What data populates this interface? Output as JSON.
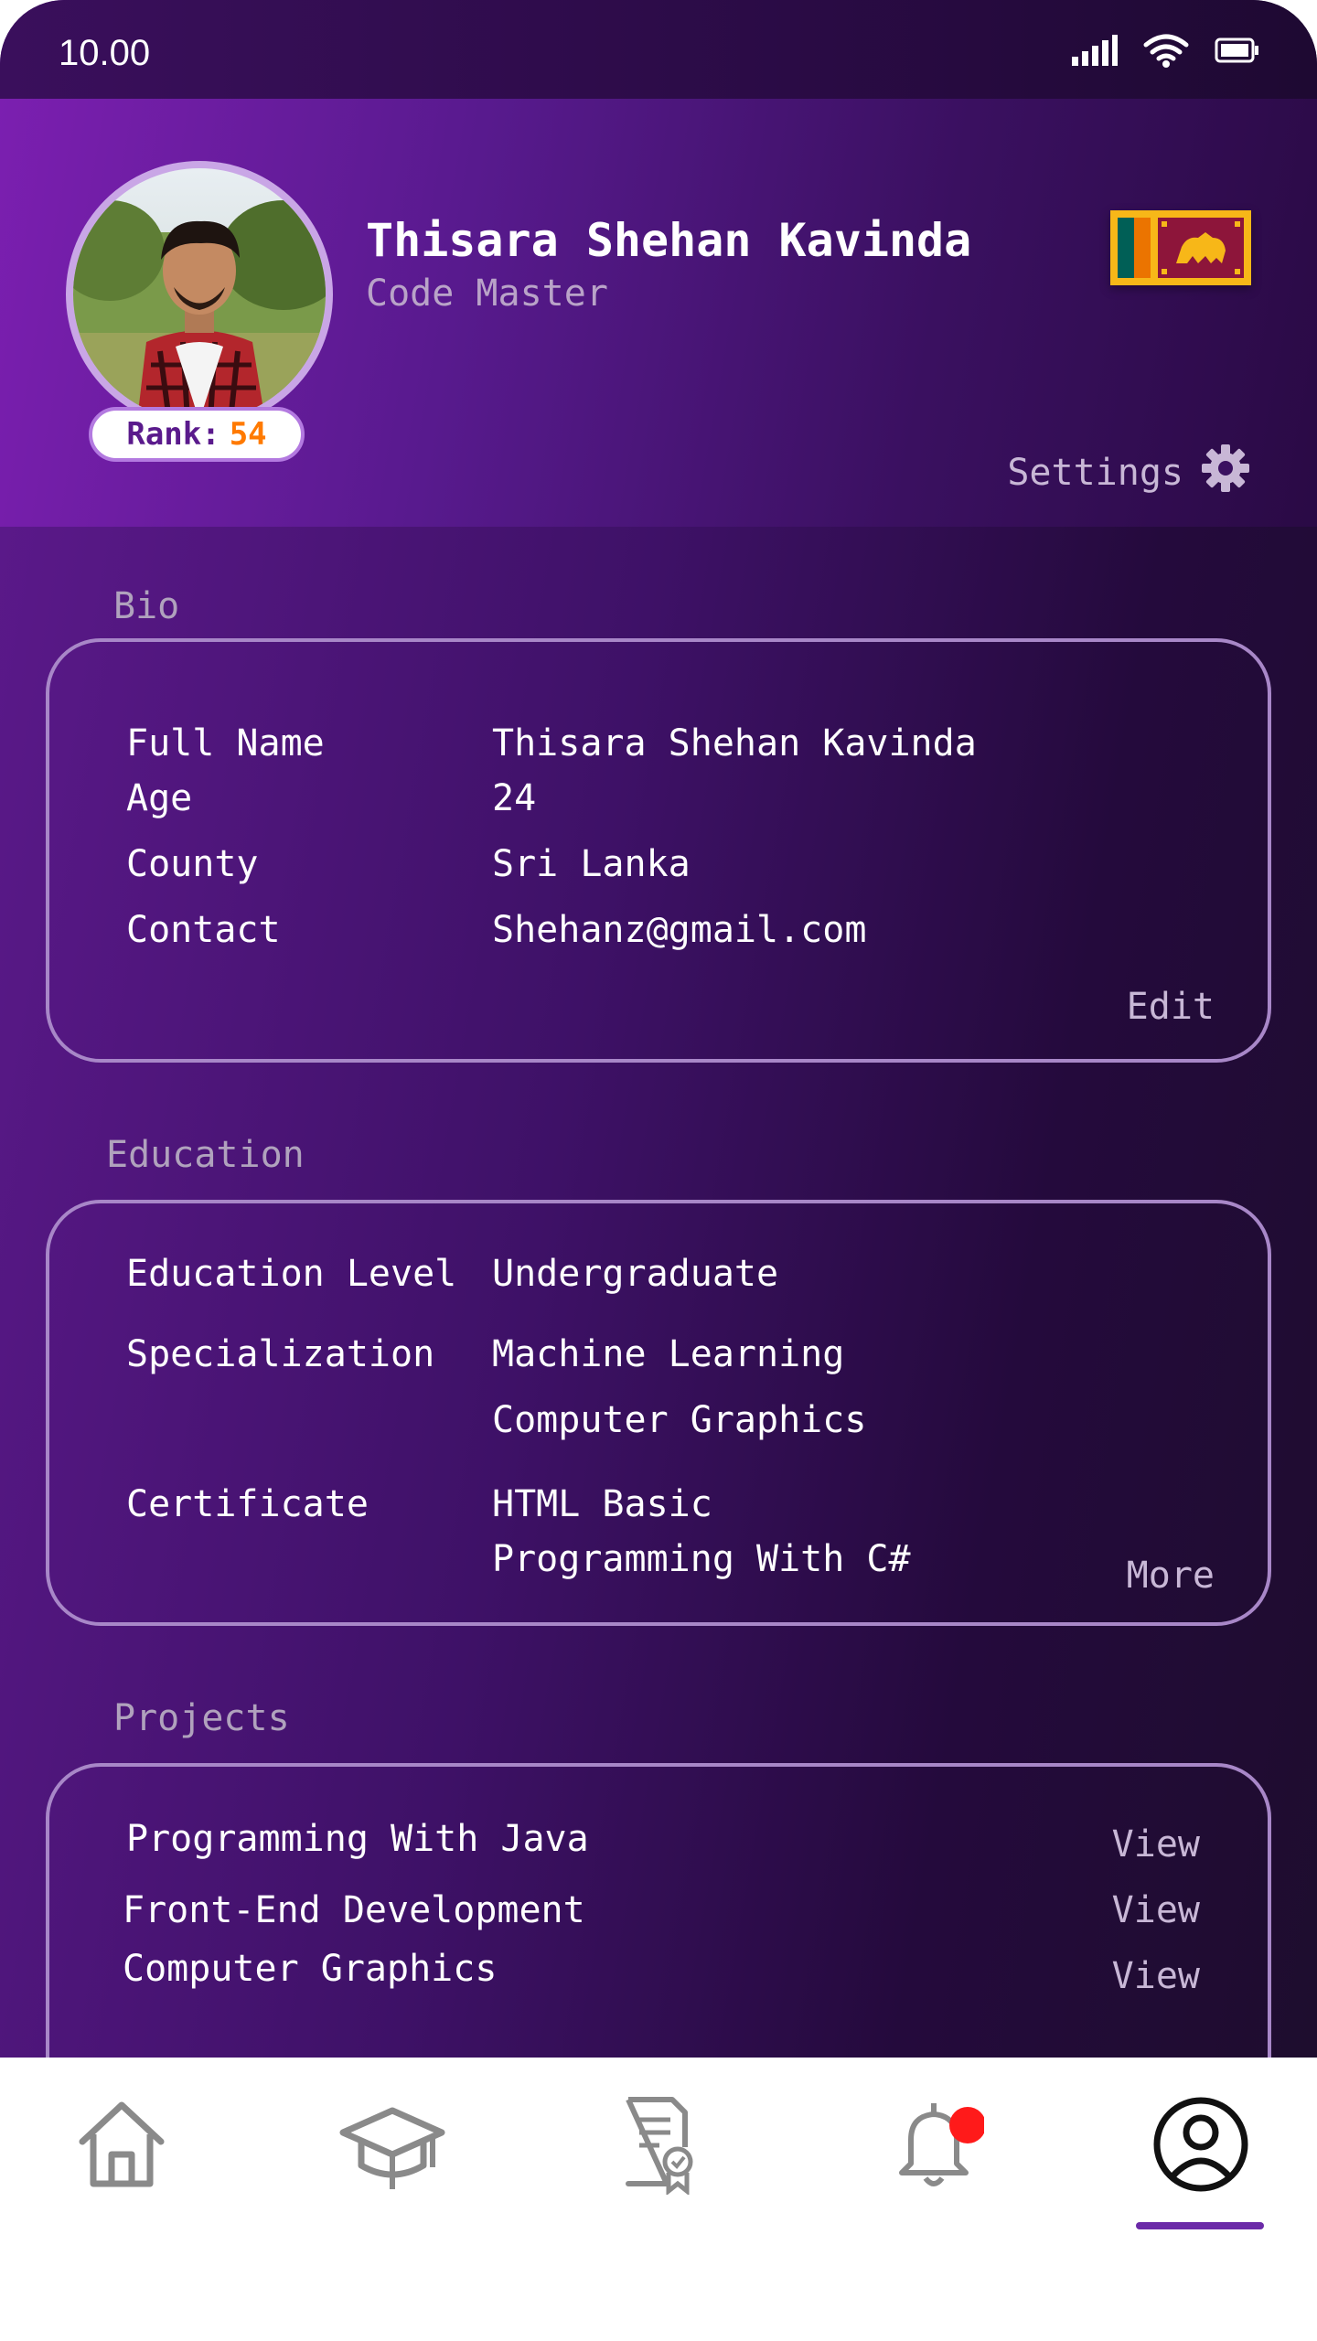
{
  "status_bar": {
    "time": "10.00",
    "icons": [
      "signal-icon",
      "wifi-icon",
      "battery-icon"
    ]
  },
  "profile": {
    "name": "Thisara Shehan Kavinda",
    "title": "Code Master",
    "rank_label": "Rank:",
    "rank_value": "54",
    "settings_label": "Settings",
    "flag": "sri-lanka-flag"
  },
  "bio": {
    "section_label": "Bio",
    "rows": [
      {
        "label": "Full Name",
        "value": "Thisara Shehan Kavinda"
      },
      {
        "label": "Age",
        "value": "24"
      },
      {
        "label": "County",
        "value": "Sri Lanka"
      },
      {
        "label": "Contact",
        "value": "Shehanz@gmail.com"
      }
    ],
    "edit_label": "Edit"
  },
  "education": {
    "section_label": "Education",
    "level_label": "Education Level",
    "level_value": "Undergraduate",
    "specialization_label": "Specialization",
    "specializations": [
      "Machine Learning",
      "Computer Graphics"
    ],
    "certificate_label": "Certificate",
    "certificates": [
      "HTML Basic",
      "Programming With C#"
    ],
    "more_label": "More"
  },
  "projects": {
    "section_label": "Projects",
    "items": [
      {
        "name": "Programming With Java",
        "action": "View"
      },
      {
        "name": "Front-End Development",
        "action": "View"
      },
      {
        "name": "Computer Graphics",
        "action": "View"
      }
    ]
  },
  "bottom_nav": {
    "items": [
      "home-icon",
      "graduation-cap-icon",
      "certificate-icon",
      "bell-icon",
      "profile-icon"
    ],
    "active": "profile-icon",
    "notification_dot_color": "#ff1a1a"
  },
  "colors": {
    "accent": "#6b2aa8",
    "rank": "#ff7a00",
    "muted_text": "#b9a3c8"
  }
}
